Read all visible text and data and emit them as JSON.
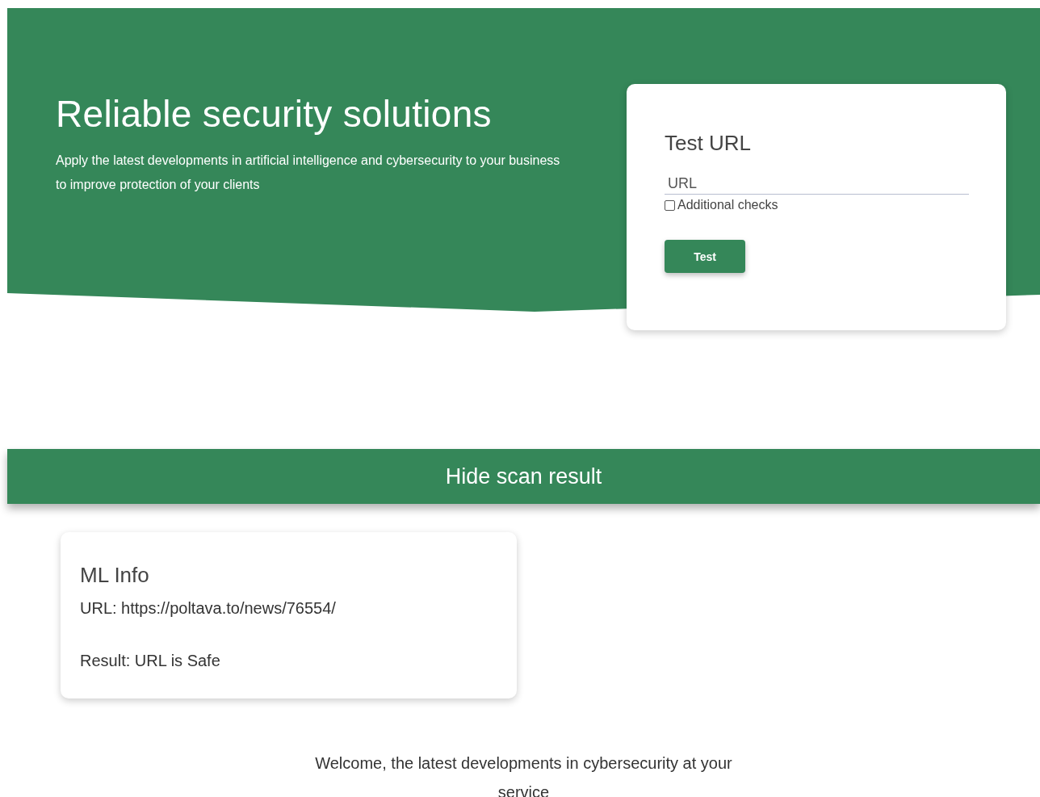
{
  "hero": {
    "title": "Reliable security solutions",
    "subtitle": "Apply the latest developments in artificial intelligence and cybersecurity to your business to improve protection of your clients"
  },
  "test_form": {
    "title": "Test URL",
    "url_field": {
      "placeholder": "URL"
    },
    "additional_checks": {
      "label": "Additional checks",
      "checked": false
    },
    "button": "Test"
  },
  "scan_toggle": {
    "label": "Hide scan result"
  },
  "ml_info": {
    "title": "ML Info",
    "url_line": "URL: https://poltava.to/news/76554/",
    "result_line": "Result: URL is Safe"
  },
  "footer_text": "Welcome, the latest developments in cybersecurity at your service"
}
